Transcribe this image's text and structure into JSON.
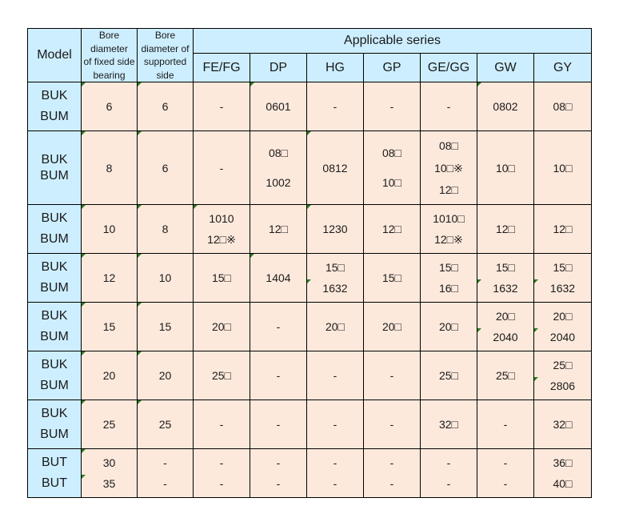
{
  "header": {
    "model": "Model",
    "fixed_bore": [
      "Bore",
      "diameter",
      "of fixed side",
      "bearing"
    ],
    "supported_bore": [
      "Bore",
      "diameter of",
      "supported",
      "side"
    ],
    "applicable_series": "Applicable series",
    "series": [
      "FE/FG",
      "DP",
      "HG",
      "GP",
      "GE/GG",
      "GW",
      "GY"
    ]
  },
  "rows": [
    {
      "model": [
        "BUK",
        "BUM"
      ],
      "fixed": [
        "6"
      ],
      "supported": [
        "6"
      ],
      "series": [
        [
          "-"
        ],
        [
          "0601"
        ],
        [
          "-"
        ],
        [
          "-"
        ],
        [
          "-"
        ],
        [
          "0802"
        ],
        [
          "08□"
        ]
      ]
    },
    {
      "model": [
        "BUK",
        "BUM"
      ],
      "fixed": [
        "8"
      ],
      "supported": [
        "6"
      ],
      "series": [
        [
          "-"
        ],
        [
          "08□",
          "1002"
        ],
        [
          "0812"
        ],
        [
          "08□",
          "10□"
        ],
        [
          "08□",
          "10□※",
          "12□"
        ],
        [
          "10□"
        ],
        [
          "10□"
        ]
      ]
    },
    {
      "model": [
        "BUK",
        "BUM"
      ],
      "fixed": [
        "10"
      ],
      "supported": [
        "8"
      ],
      "series": [
        [
          "1010",
          "12□※"
        ],
        [
          "12□"
        ],
        [
          "1230"
        ],
        [
          "12□"
        ],
        [
          "1010□",
          "12□※"
        ],
        [
          "12□"
        ],
        [
          "12□"
        ]
      ]
    },
    {
      "model": [
        "BUK",
        "BUM"
      ],
      "fixed": [
        "12"
      ],
      "supported": [
        "10"
      ],
      "series": [
        [
          "15□"
        ],
        [
          "1404"
        ],
        [
          "15□",
          "1632"
        ],
        [
          "15□"
        ],
        [
          "15□",
          "16□"
        ],
        [
          "15□",
          "1632"
        ],
        [
          "15□",
          "1632"
        ]
      ]
    },
    {
      "model": [
        "BUK",
        "BUM"
      ],
      "fixed": [
        "15"
      ],
      "supported": [
        "15"
      ],
      "series": [
        [
          "20□"
        ],
        [
          "-"
        ],
        [
          "20□"
        ],
        [
          "20□"
        ],
        [
          "20□"
        ],
        [
          "20□",
          "2040"
        ],
        [
          "20□",
          "2040"
        ]
      ]
    },
    {
      "model": [
        "BUK",
        "BUM"
      ],
      "fixed": [
        "20"
      ],
      "supported": [
        "20"
      ],
      "series": [
        [
          "25□"
        ],
        [
          "-"
        ],
        [
          "-"
        ],
        [
          "-"
        ],
        [
          "25□"
        ],
        [
          "25□"
        ],
        [
          "25□",
          "2806"
        ]
      ]
    },
    {
      "model": [
        "BUK",
        "BUM"
      ],
      "fixed": [
        "25"
      ],
      "supported": [
        "25"
      ],
      "series": [
        [
          "-"
        ],
        [
          "-"
        ],
        [
          "-"
        ],
        [
          "-"
        ],
        [
          "32□"
        ],
        [
          "-"
        ],
        [
          "32□"
        ]
      ]
    },
    {
      "model": [
        "BUT",
        "BUT"
      ],
      "fixed": [
        "30",
        "35"
      ],
      "supported": [
        "-",
        "-"
      ],
      "series": [
        [
          "-",
          "-"
        ],
        [
          "-",
          "-"
        ],
        [
          "-",
          "-"
        ],
        [
          "-",
          "-"
        ],
        [
          "-",
          "-"
        ],
        [
          "-",
          "-"
        ],
        [
          "36□",
          "40□"
        ]
      ]
    }
  ],
  "indicator_color": "#2a7d1e"
}
